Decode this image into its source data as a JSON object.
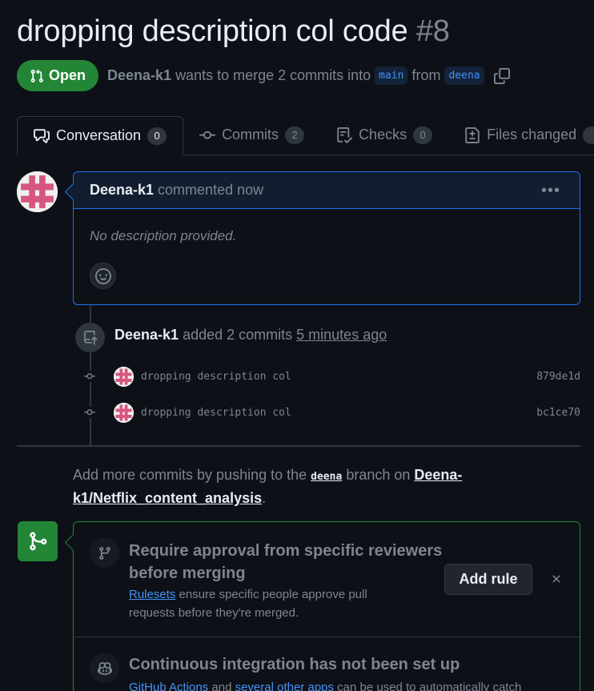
{
  "pr": {
    "title": "dropping description col code",
    "number": "#8",
    "state": "Open",
    "author": "Deena-k1",
    "merge_text_1": "wants to merge 2 commits into",
    "base_branch": "main",
    "merge_text_2": "from",
    "head_branch": "deena"
  },
  "tabs": [
    {
      "label": "Conversation",
      "count": "0",
      "icon": "conversation-icon"
    },
    {
      "label": "Commits",
      "count": "2",
      "icon": "commit-icon"
    },
    {
      "label": "Checks",
      "count": "0",
      "icon": "checks-icon"
    },
    {
      "label": "Files changed",
      "count": "",
      "icon": "file-diff-icon"
    }
  ],
  "comment": {
    "author": "Deena-k1",
    "action": "commented now",
    "body": "No description provided."
  },
  "event": {
    "author": "Deena-k1",
    "action": "added 2 commits",
    "time": "5 minutes ago"
  },
  "commits": [
    {
      "message": "dropping description col",
      "sha": "879de1d"
    },
    {
      "message": "dropping description col",
      "sha": "bc1ce70"
    }
  ],
  "push_note": {
    "prefix": "Add more commits by pushing to the",
    "branch": "deena",
    "middle": "branch on",
    "repo_part1": "Deena-",
    "repo_part2": "k1/Netflix_content_analysis",
    "suffix": "."
  },
  "merge": {
    "rule_title_line1": "Require approval from specific reviewers",
    "rule_title_line2": "before merging",
    "rule_link": "Rulesets",
    "rule_desc_1": "ensure specific people approve pull",
    "rule_desc_2": "requests before they're merged.",
    "add_rule_label": "Add rule",
    "ci_title": "Continuous integration has not been set up",
    "ci_link_1": "GitHub Actions",
    "ci_and": "and",
    "ci_link_2": "several other apps",
    "ci_desc": "can be used to automatically catch"
  },
  "colors": {
    "open_green": "#238636",
    "link_blue": "#4493f8",
    "background": "#0d1117"
  }
}
